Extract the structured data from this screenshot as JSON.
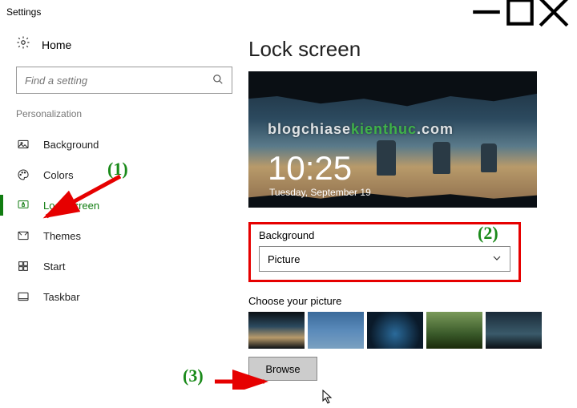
{
  "window": {
    "title": "Settings"
  },
  "sidebar": {
    "home": "Home",
    "search_placeholder": "Find a setting",
    "section": "Personalization",
    "items": [
      {
        "label": "Background"
      },
      {
        "label": "Colors"
      },
      {
        "label": "Lock screen"
      },
      {
        "label": "Themes"
      },
      {
        "label": "Start"
      },
      {
        "label": "Taskbar"
      }
    ]
  },
  "main": {
    "title": "Lock screen",
    "preview": {
      "time": "10:25",
      "date": "Tuesday, September 19",
      "watermark_prefix": "blogchiase",
      "watermark_highlight": "kienthuc",
      "watermark_suffix": ".com"
    },
    "background_label": "Background",
    "background_value": "Picture",
    "choose_label": "Choose your picture",
    "browse": "Browse"
  },
  "annotations": {
    "a1": "(1)",
    "a2": "(2)",
    "a3": "(3)"
  }
}
